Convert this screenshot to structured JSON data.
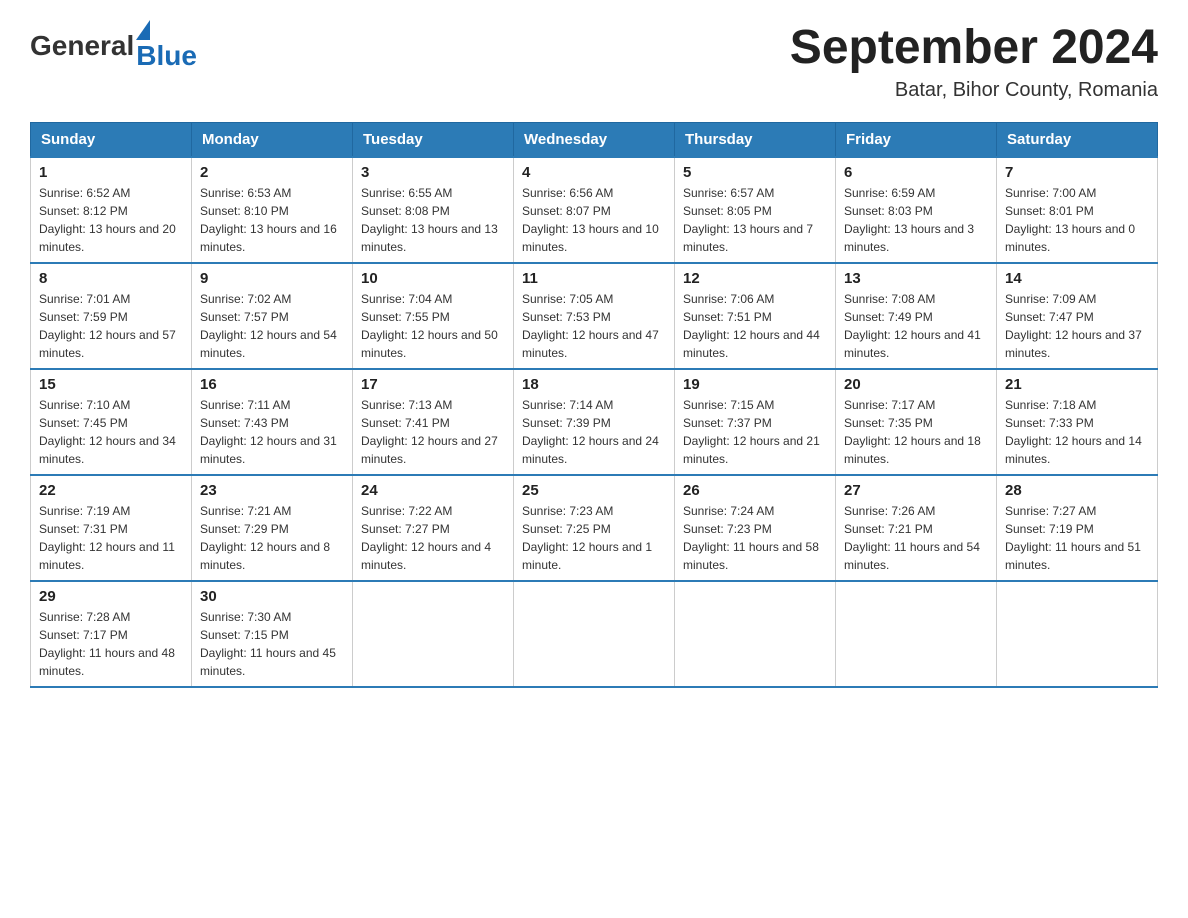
{
  "header": {
    "logo": {
      "general": "General",
      "blue": "Blue",
      "arrow_color": "#1a6bb5"
    },
    "title": "September 2024",
    "location": "Batar, Bihor County, Romania"
  },
  "calendar": {
    "days_of_week": [
      "Sunday",
      "Monday",
      "Tuesday",
      "Wednesday",
      "Thursday",
      "Friday",
      "Saturday"
    ],
    "weeks": [
      [
        {
          "day": "1",
          "sunrise": "6:52 AM",
          "sunset": "8:12 PM",
          "daylight": "13 hours and 20 minutes."
        },
        {
          "day": "2",
          "sunrise": "6:53 AM",
          "sunset": "8:10 PM",
          "daylight": "13 hours and 16 minutes."
        },
        {
          "day": "3",
          "sunrise": "6:55 AM",
          "sunset": "8:08 PM",
          "daylight": "13 hours and 13 minutes."
        },
        {
          "day": "4",
          "sunrise": "6:56 AM",
          "sunset": "8:07 PM",
          "daylight": "13 hours and 10 minutes."
        },
        {
          "day": "5",
          "sunrise": "6:57 AM",
          "sunset": "8:05 PM",
          "daylight": "13 hours and 7 minutes."
        },
        {
          "day": "6",
          "sunrise": "6:59 AM",
          "sunset": "8:03 PM",
          "daylight": "13 hours and 3 minutes."
        },
        {
          "day": "7",
          "sunrise": "7:00 AM",
          "sunset": "8:01 PM",
          "daylight": "13 hours and 0 minutes."
        }
      ],
      [
        {
          "day": "8",
          "sunrise": "7:01 AM",
          "sunset": "7:59 PM",
          "daylight": "12 hours and 57 minutes."
        },
        {
          "day": "9",
          "sunrise": "7:02 AM",
          "sunset": "7:57 PM",
          "daylight": "12 hours and 54 minutes."
        },
        {
          "day": "10",
          "sunrise": "7:04 AM",
          "sunset": "7:55 PM",
          "daylight": "12 hours and 50 minutes."
        },
        {
          "day": "11",
          "sunrise": "7:05 AM",
          "sunset": "7:53 PM",
          "daylight": "12 hours and 47 minutes."
        },
        {
          "day": "12",
          "sunrise": "7:06 AM",
          "sunset": "7:51 PM",
          "daylight": "12 hours and 44 minutes."
        },
        {
          "day": "13",
          "sunrise": "7:08 AM",
          "sunset": "7:49 PM",
          "daylight": "12 hours and 41 minutes."
        },
        {
          "day": "14",
          "sunrise": "7:09 AM",
          "sunset": "7:47 PM",
          "daylight": "12 hours and 37 minutes."
        }
      ],
      [
        {
          "day": "15",
          "sunrise": "7:10 AM",
          "sunset": "7:45 PM",
          "daylight": "12 hours and 34 minutes."
        },
        {
          "day": "16",
          "sunrise": "7:11 AM",
          "sunset": "7:43 PM",
          "daylight": "12 hours and 31 minutes."
        },
        {
          "day": "17",
          "sunrise": "7:13 AM",
          "sunset": "7:41 PM",
          "daylight": "12 hours and 27 minutes."
        },
        {
          "day": "18",
          "sunrise": "7:14 AM",
          "sunset": "7:39 PM",
          "daylight": "12 hours and 24 minutes."
        },
        {
          "day": "19",
          "sunrise": "7:15 AM",
          "sunset": "7:37 PM",
          "daylight": "12 hours and 21 minutes."
        },
        {
          "day": "20",
          "sunrise": "7:17 AM",
          "sunset": "7:35 PM",
          "daylight": "12 hours and 18 minutes."
        },
        {
          "day": "21",
          "sunrise": "7:18 AM",
          "sunset": "7:33 PM",
          "daylight": "12 hours and 14 minutes."
        }
      ],
      [
        {
          "day": "22",
          "sunrise": "7:19 AM",
          "sunset": "7:31 PM",
          "daylight": "12 hours and 11 minutes."
        },
        {
          "day": "23",
          "sunrise": "7:21 AM",
          "sunset": "7:29 PM",
          "daylight": "12 hours and 8 minutes."
        },
        {
          "day": "24",
          "sunrise": "7:22 AM",
          "sunset": "7:27 PM",
          "daylight": "12 hours and 4 minutes."
        },
        {
          "day": "25",
          "sunrise": "7:23 AM",
          "sunset": "7:25 PM",
          "daylight": "12 hours and 1 minute."
        },
        {
          "day": "26",
          "sunrise": "7:24 AM",
          "sunset": "7:23 PM",
          "daylight": "11 hours and 58 minutes."
        },
        {
          "day": "27",
          "sunrise": "7:26 AM",
          "sunset": "7:21 PM",
          "daylight": "11 hours and 54 minutes."
        },
        {
          "day": "28",
          "sunrise": "7:27 AM",
          "sunset": "7:19 PM",
          "daylight": "11 hours and 51 minutes."
        }
      ],
      [
        {
          "day": "29",
          "sunrise": "7:28 AM",
          "sunset": "7:17 PM",
          "daylight": "11 hours and 48 minutes."
        },
        {
          "day": "30",
          "sunrise": "7:30 AM",
          "sunset": "7:15 PM",
          "daylight": "11 hours and 45 minutes."
        },
        null,
        null,
        null,
        null,
        null
      ]
    ]
  }
}
